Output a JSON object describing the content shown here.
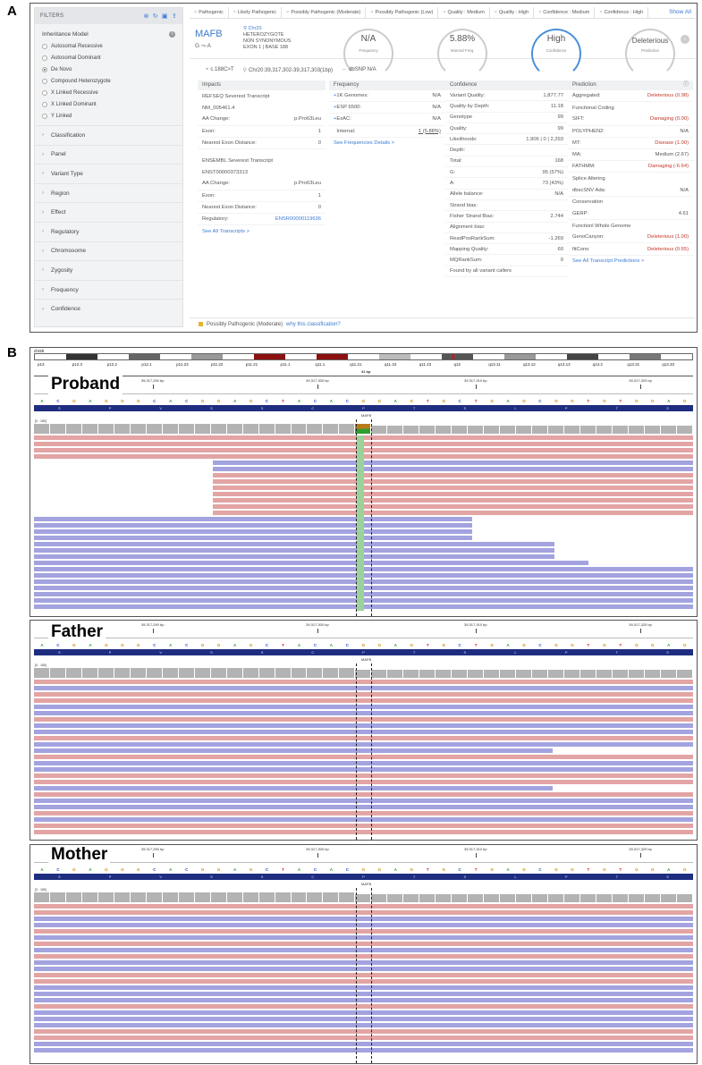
{
  "figure": {
    "label_a": "A",
    "label_b": "B"
  },
  "filters": {
    "title": "FILTERS",
    "icons": [
      "filter-clear-icon",
      "reset-icon",
      "save-icon",
      "upload-icon"
    ],
    "inheritance_title": "Inheritance Model",
    "inheritance_options": [
      {
        "label": "Autosomal Recessive",
        "selected": false
      },
      {
        "label": "Autosomal Dominant",
        "selected": false
      },
      {
        "label": "De Novo",
        "selected": true
      },
      {
        "label": "Compound Heterozygote",
        "selected": false
      },
      {
        "label": "X Linked Recessive",
        "selected": false
      },
      {
        "label": "X Linked Dominant",
        "selected": false
      },
      {
        "label": "Y Linked",
        "selected": false
      }
    ],
    "categories": [
      "Classification",
      "Panel",
      "Variant Type",
      "Region",
      "Effect",
      "Regulatory",
      "Chromosome",
      "Zygosity",
      "Frequency",
      "Confidence"
    ]
  },
  "tags": [
    "Pathogenic",
    "Likely Pathogenic",
    "Possibly Pathogenic (Moderate)",
    "Possibly Pathogenic (Low)",
    "Quality : Medium",
    "Quality : High",
    "Confidence : Medium",
    "Confidence : High"
  ],
  "show_all": "Show All",
  "variant": {
    "gene": "MAFB",
    "change": "G ⤳ A",
    "chr": "Chr20",
    "zygosity": "HETEROZYGOTE",
    "effect": "NON SYNONYMOUS",
    "exon": "EXON 1 | BASE 188",
    "gauges": [
      {
        "value": "N/A",
        "caption": "Frequency"
      },
      {
        "value": "5.88%",
        "caption": "Internal Freq."
      },
      {
        "value": "High",
        "caption": "Confidence"
      },
      {
        "value": "Deleterious",
        "caption": "Prediction"
      }
    ],
    "hgvs": "c.188C>T",
    "position": "Chr20:39,317,302-39,317,303(1bp)",
    "dbsnp": "dbSNP N/A"
  },
  "impacts": {
    "title": "Impacts",
    "refseq_title": "REFSEQ Severest Transcript",
    "refseq_id": "NM_005461.4",
    "refseq": [
      {
        "k": "AA Change:",
        "v": "p.Pro63Leu"
      },
      {
        "k": "Exon:",
        "v": "1"
      },
      {
        "k": "Nearest Exon Distance:",
        "v": "0"
      }
    ],
    "ensembl_title": "ENSEMBL Severest Transcript",
    "ensembl_id": "ENST00000373313",
    "ensembl": [
      {
        "k": "AA Change:",
        "v": "p.Pro63Leu"
      },
      {
        "k": "Exon:",
        "v": "1"
      },
      {
        "k": "Nearest Exon Distance:",
        "v": "0"
      },
      {
        "k": "Regulatory:",
        "v": "ENSR00000119636"
      }
    ],
    "see_all": "See All Transcripts >"
  },
  "frequency": {
    "title": "Frequency",
    "rows": [
      {
        "k": "1K Genomes:",
        "v": "N/A"
      },
      {
        "k": "ESP 6500:",
        "v": "N/A"
      },
      {
        "k": "ExAC:",
        "v": "N/A"
      },
      {
        "k": "Internal:",
        "v": "1 (5.88%)"
      }
    ],
    "see_details": "See Frequencies Details >"
  },
  "confidence": {
    "title": "Confidence",
    "rows": [
      {
        "k": "Variant Quality:",
        "v": "1,877.77"
      },
      {
        "k": "Quality by Depth:",
        "v": "11.18"
      },
      {
        "k": "Genotype",
        "v": "99"
      },
      {
        "k": "Quality:",
        "v": "99"
      },
      {
        "k": "Likelihoods:",
        "v": "1,906 | 0 | 2,293"
      },
      {
        "k": "Depth:",
        "v": ""
      },
      {
        "k": "Total:",
        "v": "168"
      },
      {
        "k": "G:",
        "v": "95 (57%)"
      },
      {
        "k": "A:",
        "v": "73 (43%)"
      },
      {
        "k": "Allele balance:",
        "v": "N/A"
      },
      {
        "k": "Strand bias:",
        "v": ""
      },
      {
        "k": "Fisher Strand Bias:",
        "v": "2.744"
      },
      {
        "k": "Alignment bias:",
        "v": ""
      },
      {
        "k": "ReadPosRankSum:",
        "v": "-1.269"
      },
      {
        "k": "Mapping Quality:",
        "v": "60"
      },
      {
        "k": "MQRankSum:",
        "v": "0"
      },
      {
        "k": "Found by all variant callers",
        "v": ""
      }
    ]
  },
  "prediction": {
    "title": "Prediction",
    "aggregated_k": "Aggregated:",
    "aggregated_v": "Deleterious (0.98)",
    "functional_coding": "Functional Coding",
    "coding": [
      {
        "k": "SIFT:",
        "v": "Damaging (0.00)",
        "red": true
      },
      {
        "k": "POLYPHEN2:",
        "v": "N/A",
        "red": false
      },
      {
        "k": "MT:",
        "v": "Disease (1.00)",
        "red": true
      },
      {
        "k": "MA:",
        "v": "Medium (2.67)",
        "red": false
      },
      {
        "k": "FATHMM:",
        "v": "Damaging (-6.64)",
        "red": true
      }
    ],
    "splice_title": "Splice Altering",
    "splice_k": "dbscSNV Ada:",
    "splice_v": "N/A",
    "conservation_title": "Conservation",
    "gerp_k": "GERP:",
    "gerp_v": "4.61",
    "whole_genome_title": "Functionl Whole Genome",
    "whole": [
      {
        "k": "GenoCanyon:",
        "v": "Deleterious (1.00)"
      },
      {
        "k": "fitCons:",
        "v": "Deleterious (0.65)"
      }
    ],
    "see_all": "See All Transcript Predictions >"
  },
  "classification_bar": {
    "label": "Possibly Pathogenic (Moderate)",
    "link": "why this classification?"
  },
  "igv": {
    "chromosome": "chr20",
    "ideogram_bands": [
      "p13",
      "p12.3",
      "p12.2",
      "p12.1",
      "p11.23",
      "p11.22",
      "p11.21",
      "p11.1",
      "q11.1",
      "q11.21",
      "q11.22",
      "q11.23",
      "q12",
      "q13.11",
      "q13.12",
      "q13.13",
      "q13.2",
      "q13.31",
      "q13.33"
    ],
    "span": "41 bp",
    "ticks": [
      "39,317,290 bp",
      "39,317,300 bp",
      "39,317,310 bp",
      "39,317,320 bp"
    ],
    "sequence": [
      "A",
      "C",
      "G",
      "A",
      "G",
      "G",
      "G",
      "C",
      "A",
      "C",
      "G",
      "G",
      "A",
      "G",
      "C",
      "T",
      "A",
      "C",
      "A",
      "C",
      "G",
      "G",
      "A",
      "G",
      "T",
      "G",
      "C",
      "T",
      "G",
      "A",
      "G",
      "C",
      "G",
      "G",
      "T",
      "G",
      "T",
      "G",
      "G",
      "A",
      "G"
    ],
    "amino_acids": [
      "S",
      "P",
      "V",
      "S",
      "S",
      "C",
      "P",
      "T",
      "S",
      "L",
      "P",
      "T",
      "S"
    ],
    "gene": "MAFB",
    "coverage_label": "[0 - 180]",
    "tracks": [
      {
        "title": "Proband"
      },
      {
        "title": "Father"
      },
      {
        "title": "Mother"
      }
    ]
  }
}
